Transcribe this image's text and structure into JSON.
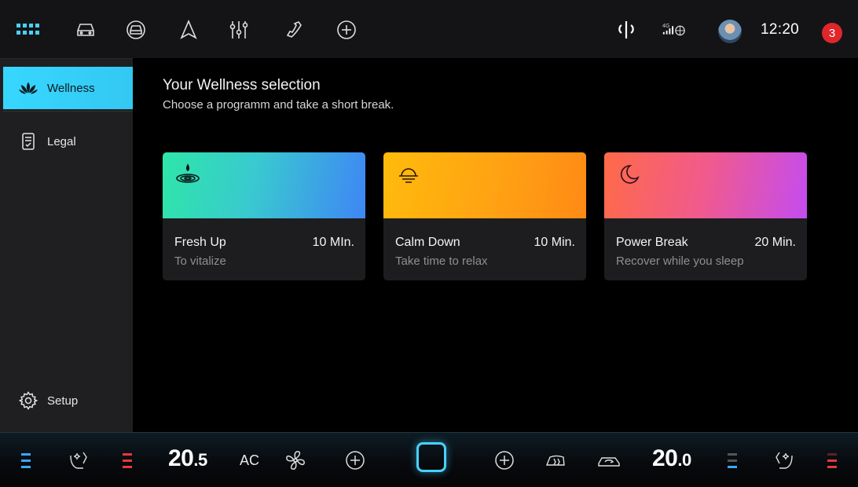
{
  "top_bar": {
    "clock": "12:20",
    "notification_count": "3",
    "icons": [
      "apps-grid-icon",
      "car-icon",
      "car-front-icon",
      "navigation-arrow-icon",
      "equalizer-icon",
      "phone-icon",
      "add-icon",
      "wireless-charging-icon",
      "signal-4g-icon",
      "user-avatar"
    ]
  },
  "sidebar": {
    "items": [
      {
        "label": "Wellness",
        "icon": "lotus-icon",
        "active": true
      },
      {
        "label": "Legal",
        "icon": "document-icon",
        "active": false
      }
    ],
    "setup_label": "Setup",
    "setup_icon": "gear-icon"
  },
  "main": {
    "title": "Your Wellness selection",
    "subtitle": "Choose a programm and take a short break."
  },
  "cards": [
    {
      "title": "Fresh Up",
      "duration": "10 MIn.",
      "subtitle": "To vitalize",
      "icon": "water-drop-ripple-icon",
      "gradient": [
        "#2ee6a8",
        "#3f86f5"
      ]
    },
    {
      "title": "Calm Down",
      "duration": "10 Min.",
      "subtitle": "Take time to relax",
      "icon": "sunset-icon",
      "gradient": [
        "#ffb70a",
        "#ff8a15"
      ]
    },
    {
      "title": "Power Break",
      "duration": "20 Min.",
      "subtitle": "Recover while you sleep",
      "icon": "moon-icon",
      "gradient": [
        "#ff6a4a",
        "#c44cf0"
      ]
    }
  ],
  "climate": {
    "left_temp_int": "20",
    "left_temp_dec": ".5",
    "right_temp_int": "20",
    "right_temp_dec": ".0",
    "ac_label": "AC",
    "accent_color": "#47d2ff",
    "heat_color": "#e8383c",
    "cool_color": "#3aa6ff"
  }
}
